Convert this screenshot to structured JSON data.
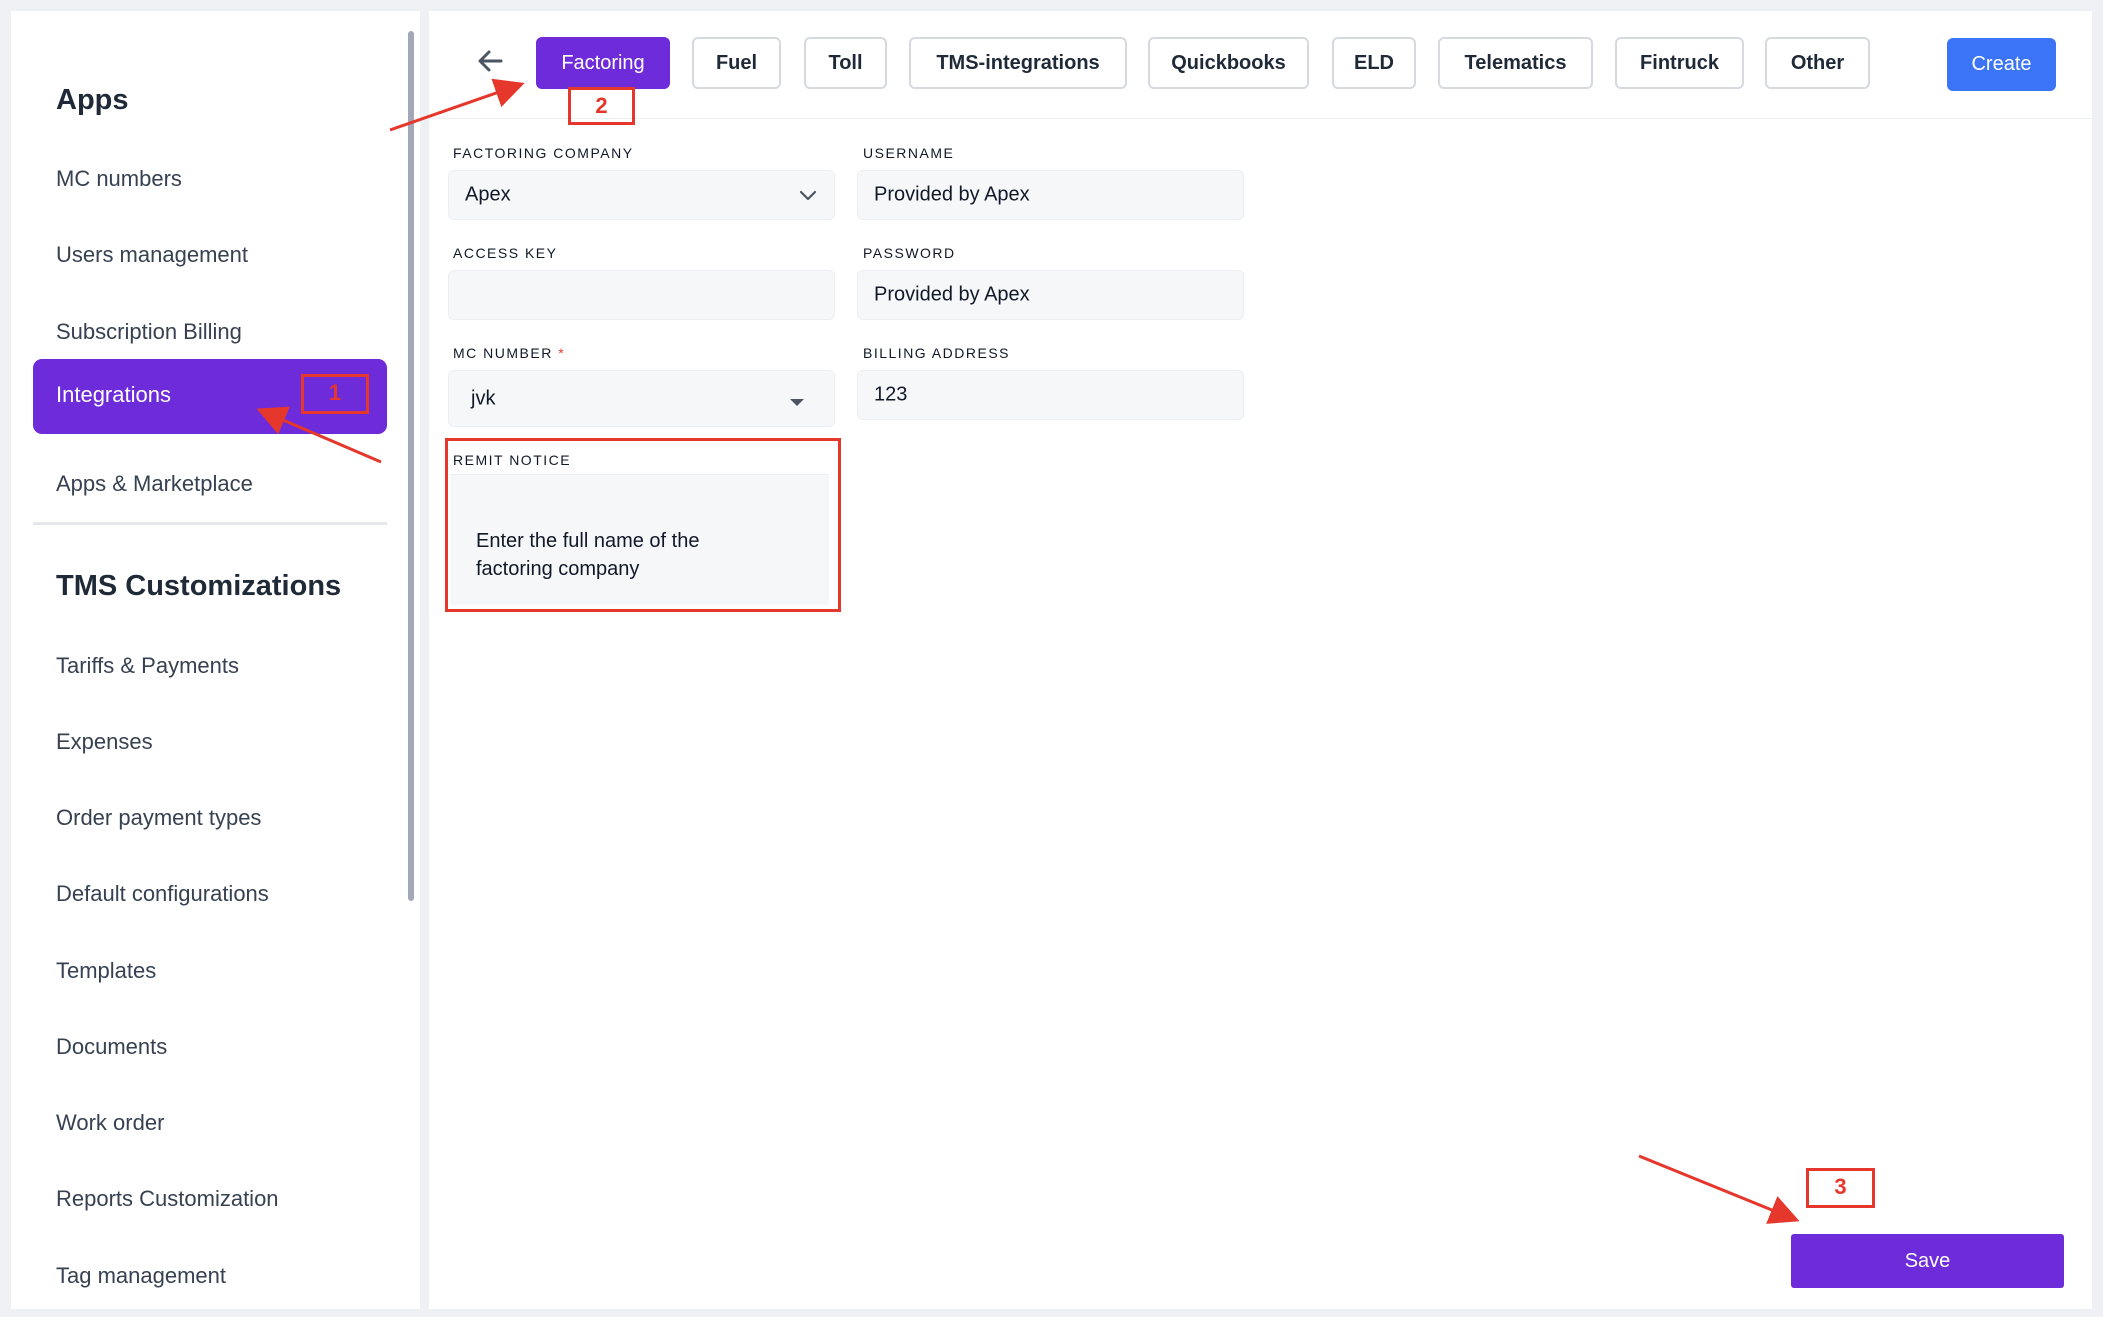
{
  "sidebar": {
    "apps_heading": "Apps",
    "apps_items": [
      {
        "label": "MC numbers"
      },
      {
        "label": "Users management"
      },
      {
        "label": "Subscription Billing"
      },
      {
        "label": "Integrations"
      },
      {
        "label": "Apps & Marketplace"
      }
    ],
    "active_item": "Integrations",
    "tms_heading": "TMS Customizations",
    "tms_items": [
      {
        "label": "Tariffs & Payments"
      },
      {
        "label": "Expenses"
      },
      {
        "label": "Order payment types"
      },
      {
        "label": "Default configurations"
      },
      {
        "label": "Templates"
      },
      {
        "label": "Documents"
      },
      {
        "label": "Work order"
      },
      {
        "label": "Reports Customization"
      },
      {
        "label": "Tag management"
      }
    ]
  },
  "toolbar": {
    "back_icon": "arrow-left-icon",
    "tabs": [
      {
        "label": "Factoring",
        "active": true
      },
      {
        "label": "Fuel"
      },
      {
        "label": "Toll"
      },
      {
        "label": "TMS-integrations"
      },
      {
        "label": "Quickbooks"
      },
      {
        "label": "ELD"
      },
      {
        "label": "Telematics"
      },
      {
        "label": "Fintruck"
      },
      {
        "label": "Other"
      }
    ],
    "create_label": "Create"
  },
  "form": {
    "factoring_company": {
      "label": "FACTORING COMPANY",
      "value": "Apex"
    },
    "username": {
      "label": "USERNAME",
      "value": "Provided by Apex"
    },
    "access_key": {
      "label": "ACCESS KEY",
      "value": ""
    },
    "password": {
      "label": "PASSWORD",
      "value": "Provided by Apex"
    },
    "mc_number": {
      "label": "MC NUMBER",
      "required_mark": "*",
      "value": "jvk"
    },
    "billing_address": {
      "label": "BILLING ADDRESS",
      "value": "123"
    },
    "remit_notice": {
      "label": "REMIT NOTICE",
      "value": "Enter the full name of the factoring company"
    }
  },
  "save_label": "Save",
  "annotations": {
    "step1": "1",
    "step2": "2",
    "step3": "3"
  },
  "colors": {
    "accent_purple": "#6d2bd9",
    "create_blue": "#3b74f6",
    "annotation_red": "#e5372b"
  }
}
